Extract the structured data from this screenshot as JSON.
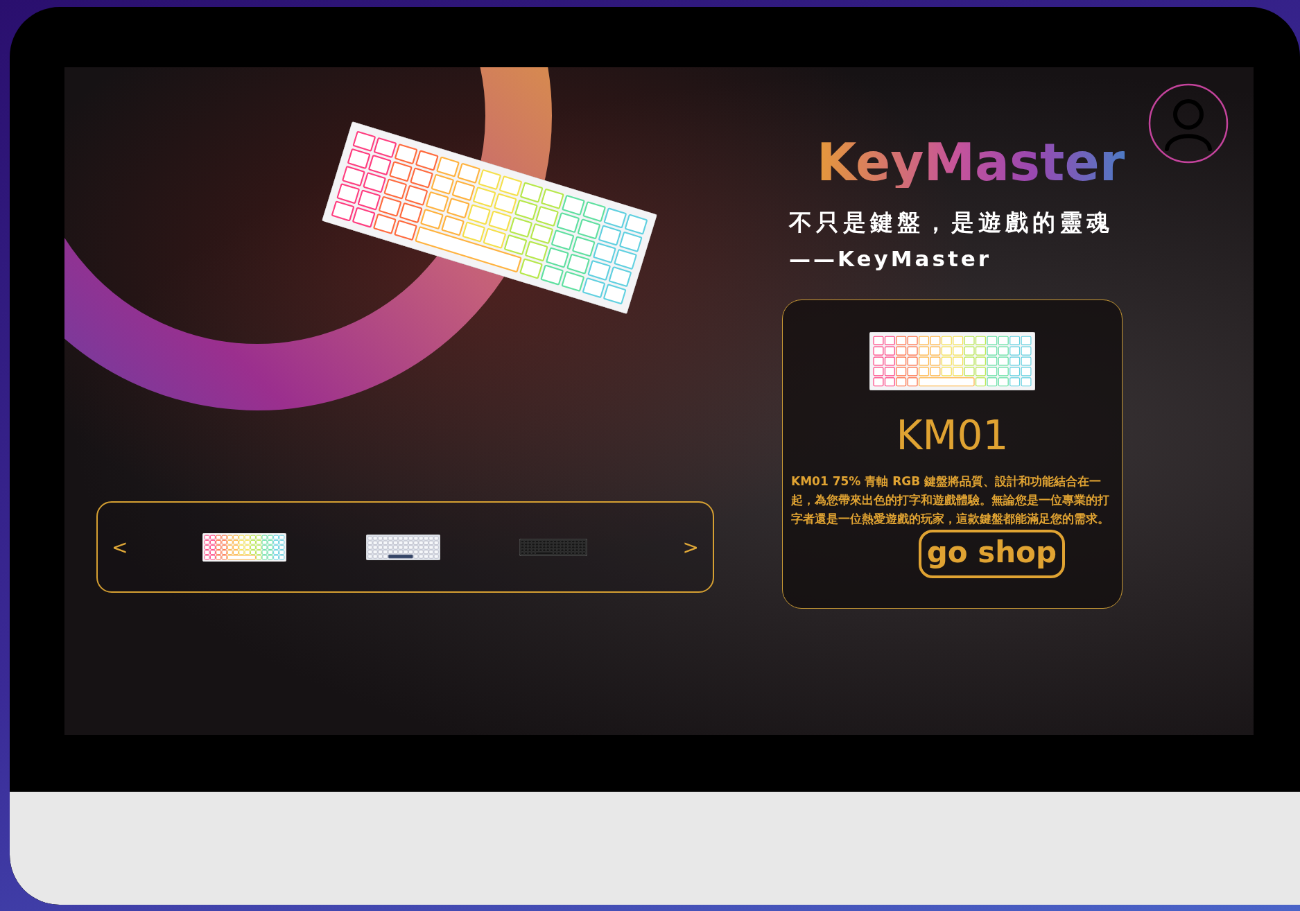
{
  "brand": "KeyMaster",
  "slogan": "不只是鍵盤，是遊戲的靈魂",
  "signature": "——KeyMaster",
  "product": {
    "name": "KM01",
    "description": "KM01 75% 青軸 RGB 鍵盤將品質、設計和功能結合在一起，為您帶來出色的打字和遊戲體驗。無論您是一位專業的打字者還是一位熱愛遊戲的玩家，這款鍵盤都能滿足您的需求。",
    "button": "go shop"
  },
  "carousel": {
    "prev": "<",
    "next": ">",
    "thumbnails": [
      {
        "kind": "rgb"
      },
      {
        "kind": "white"
      },
      {
        "kind": "black"
      }
    ]
  }
}
